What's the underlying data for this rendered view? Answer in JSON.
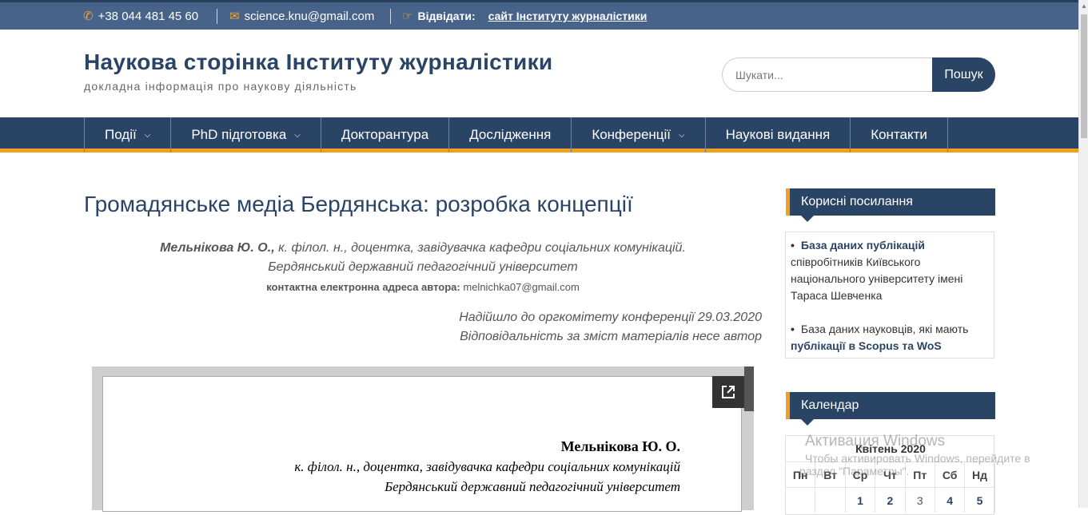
{
  "topbar": {
    "phone": "+38 044 481 45 60",
    "email": "science.knu@gmail.com",
    "visit_label": "Відвідати:",
    "visit_link": "сайт Інституту журналістики",
    "icons": {
      "phone": "phone-icon",
      "email": "envelope-icon",
      "visit": "hand-pointer-icon"
    },
    "accent": "#f0a33a"
  },
  "header": {
    "title": "Наукова сторінка Інституту журналістики",
    "description": "докладна інформація про наукову діяльність"
  },
  "search": {
    "placeholder": "Шукати...",
    "button": "Пошук"
  },
  "nav": {
    "items": [
      {
        "label": "Події",
        "dropdown": true
      },
      {
        "label": "PhD підготовка",
        "dropdown": true
      },
      {
        "label": "Докторантура",
        "dropdown": false
      },
      {
        "label": "Дослідження",
        "dropdown": false
      },
      {
        "label": "Конференції",
        "dropdown": true
      },
      {
        "label": "Наукові видання",
        "dropdown": false
      },
      {
        "label": "Контакти",
        "dropdown": false
      }
    ]
  },
  "article": {
    "title": "Громадянське медіа Бердянська: розробка концепції",
    "author_name": "Мельнікова Ю. О.,",
    "author_position": "к. філол. н., доцентка, завідувачка кафедри соціальних комунікацій.",
    "university": "Бердянський державний педагогічний університет",
    "contact_label": "контактна електронна адреса автора:",
    "contact_email": "melnichka07@gmail.com",
    "received": "Надійшло до оргкомітету конференції 29.03.2020",
    "responsibility": "Відповідальність за зміст матеріалів несе автор"
  },
  "document": {
    "author": "Мельнікова Ю. О.",
    "position": "к. філол. н., доцентка, завідувачка кафедри соціальних комунікацій",
    "university": "Бердянський державний педагогічний університет",
    "popout_icon": "open-external-icon"
  },
  "sidebar": {
    "links_title": "Корисні посилання",
    "links": [
      {
        "bold": "База даних публікацій",
        "text": "співробітників Київського національного університету імені Тараса Шевченка"
      },
      {
        "text": "База даних науковців, які мають",
        "bold": "публікації в Scopus та WoS"
      }
    ],
    "calendar_title": "Календар",
    "calendar": {
      "caption": "Квітень 2020",
      "days": [
        "Пн",
        "Вт",
        "Ср",
        "Чт",
        "Пт",
        "Сб",
        "Нд"
      ],
      "first_row": [
        "",
        "",
        "1",
        "2",
        "3",
        "4",
        "5"
      ]
    }
  },
  "watermark": {
    "line1": "Активация Windows",
    "line2": "Чтобы активировать Windows, перейдите в",
    "line3": "раздел \"Параметры\"."
  },
  "colors": {
    "primary": "#2a4466",
    "accent": "#f0a01e",
    "topbar": "#47638a"
  }
}
